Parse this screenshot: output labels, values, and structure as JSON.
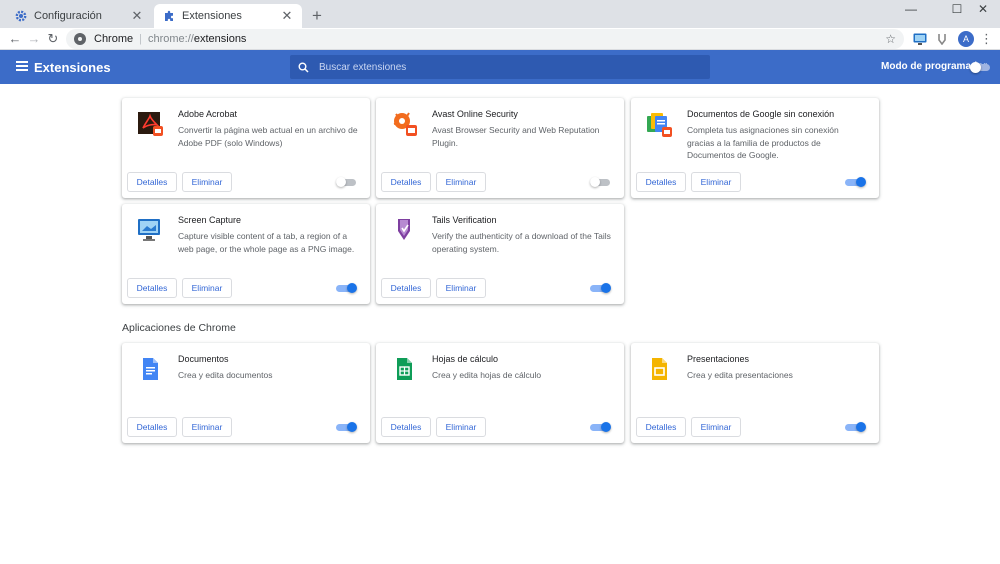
{
  "tabs": [
    {
      "title": "Configuración",
      "icon": "gear-icon"
    },
    {
      "title": "Extensiones",
      "icon": "puzzle-icon"
    }
  ],
  "window_controls": {
    "minimize": "—",
    "maximize": "☐",
    "close": "✕"
  },
  "toolbar": {
    "site_name": "Chrome",
    "url_scheme": "chrome://",
    "url_path": "extensions",
    "avatar_letter": "A"
  },
  "header": {
    "title": "Extensiones",
    "search_placeholder": "Buscar extensiones",
    "dev_mode_label": "Modo de programador",
    "dev_mode_on": false
  },
  "buttons": {
    "details": "Detalles",
    "remove": "Eliminar"
  },
  "extensions": [
    {
      "name": "Adobe Acrobat",
      "description": "Convertir la página web actual en un archivo de Adobe PDF (solo Windows)",
      "icon": "adobe-acrobat-icon",
      "enabled": false
    },
    {
      "name": "Avast Online Security",
      "description": "Avast Browser Security and Web Reputation Plugin.",
      "icon": "avast-icon",
      "enabled": false
    },
    {
      "name": "Documentos de Google sin conexión",
      "description": "Completa tus asignaciones sin conexión gracias a la familia de productos de Documentos de Google.",
      "icon": "google-docs-offline-icon",
      "enabled": true
    },
    {
      "name": "Screen Capture",
      "description": "Capture visible content of a tab, a region of a web page, or the whole page as a PNG image.",
      "icon": "screen-capture-icon",
      "enabled": true
    },
    {
      "name": "Tails Verification",
      "description": "Verify the authenticity of a download of the Tails operating system.",
      "icon": "tails-icon",
      "enabled": true
    }
  ],
  "apps_section_title": "Aplicaciones de Chrome",
  "apps": [
    {
      "name": "Documentos",
      "description": "Crea y edita documentos",
      "icon": "google-docs-icon",
      "enabled": true
    },
    {
      "name": "Hojas de cálculo",
      "description": "Crea y edita hojas de cálculo",
      "icon": "google-sheets-icon",
      "enabled": true
    },
    {
      "name": "Presentaciones",
      "description": "Crea y edita presentaciones",
      "icon": "google-slides-icon",
      "enabled": true
    }
  ],
  "colors": {
    "header_blue": "#3c6cc8",
    "toggle_on": "#1a73e8",
    "button_text": "#3367d6"
  }
}
